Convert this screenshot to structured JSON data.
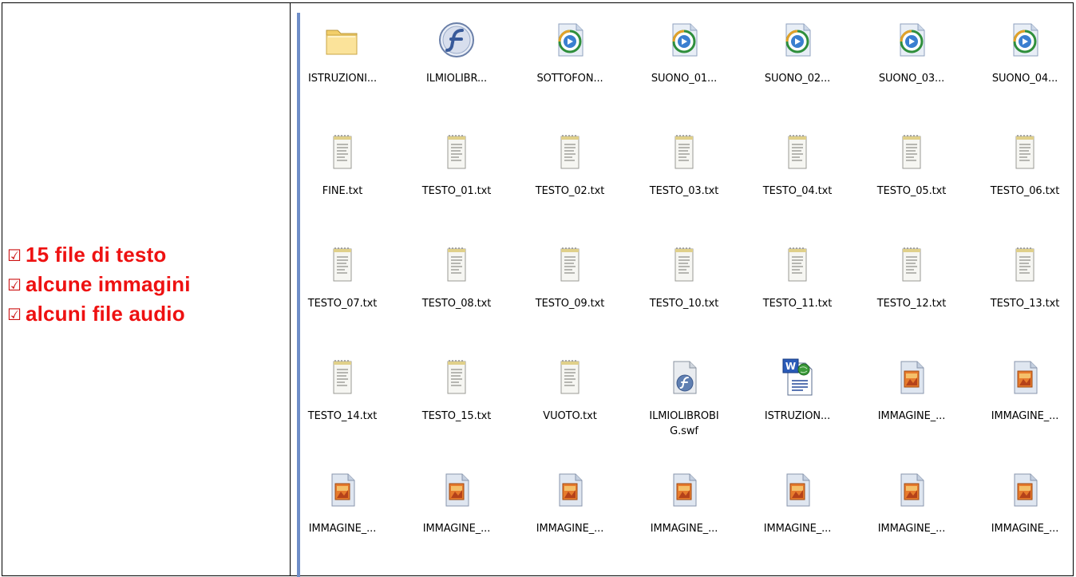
{
  "checklist": {
    "checkbox_glyph": "☑",
    "items": [
      {
        "label": "15 file di testo"
      },
      {
        "label": "alcune immagini"
      },
      {
        "label": "alcuni file audio"
      }
    ]
  },
  "colors": {
    "checklist_text": "#ee1111",
    "divider": "#6f8ec8",
    "folder": "#f3cf6a",
    "flash_icon": "#385a9a",
    "media_icon_ring": "#2f8f3c"
  },
  "explorer": {
    "rows": [
      [
        {
          "label": "ISTRUZIONI...",
          "icon": "folder-icon"
        },
        {
          "label": "ILMIOLIBR...",
          "icon": "flash-icon"
        },
        {
          "label": "SOTTOFON...",
          "icon": "media-icon"
        },
        {
          "label": "SUONO_01...",
          "icon": "media-icon"
        },
        {
          "label": "SUONO_02...",
          "icon": "media-icon"
        },
        {
          "label": "SUONO_03...",
          "icon": "media-icon"
        },
        {
          "label": "SUONO_04...",
          "icon": "media-icon"
        }
      ],
      [
        {
          "label": "FINE.txt",
          "icon": "text-file-icon"
        },
        {
          "label": "TESTO_01.txt",
          "icon": "text-file-icon"
        },
        {
          "label": "TESTO_02.txt",
          "icon": "text-file-icon"
        },
        {
          "label": "TESTO_03.txt",
          "icon": "text-file-icon"
        },
        {
          "label": "TESTO_04.txt",
          "icon": "text-file-icon"
        },
        {
          "label": "TESTO_05.txt",
          "icon": "text-file-icon"
        },
        {
          "label": "TESTO_06.txt",
          "icon": "text-file-icon"
        }
      ],
      [
        {
          "label": "TESTO_07.txt",
          "icon": "text-file-icon"
        },
        {
          "label": "TESTO_08.txt",
          "icon": "text-file-icon"
        },
        {
          "label": "TESTO_09.txt",
          "icon": "text-file-icon"
        },
        {
          "label": "TESTO_10.txt",
          "icon": "text-file-icon"
        },
        {
          "label": "TESTO_11.txt",
          "icon": "text-file-icon"
        },
        {
          "label": "TESTO_12.txt",
          "icon": "text-file-icon"
        },
        {
          "label": "TESTO_13.txt",
          "icon": "text-file-icon"
        }
      ],
      [
        {
          "label": "TESTO_14.txt",
          "icon": "text-file-icon"
        },
        {
          "label": "TESTO_15.txt",
          "icon": "text-file-icon"
        },
        {
          "label": "VUOTO.txt",
          "icon": "text-file-icon"
        },
        {
          "label": "ILMIOLIBROBI\nG.swf",
          "icon": "swf-file-icon"
        },
        {
          "label": "ISTRUZION...",
          "icon": "word-doc-icon"
        },
        {
          "label": "IMMAGINE_...",
          "icon": "image-file-icon"
        },
        {
          "label": "IMMAGINE_...",
          "icon": "image-file-icon"
        }
      ],
      [
        {
          "label": "IMMAGINE_...",
          "icon": "image-file-icon"
        },
        {
          "label": "IMMAGINE_...",
          "icon": "image-file-icon"
        },
        {
          "label": "IMMAGINE_...",
          "icon": "image-file-icon"
        },
        {
          "label": "IMMAGINE_...",
          "icon": "image-file-icon"
        },
        {
          "label": "IMMAGINE_...",
          "icon": "image-file-icon"
        },
        {
          "label": "IMMAGINE_...",
          "icon": "image-file-icon"
        },
        {
          "label": "IMMAGINE_...",
          "icon": "image-file-icon"
        }
      ]
    ]
  }
}
